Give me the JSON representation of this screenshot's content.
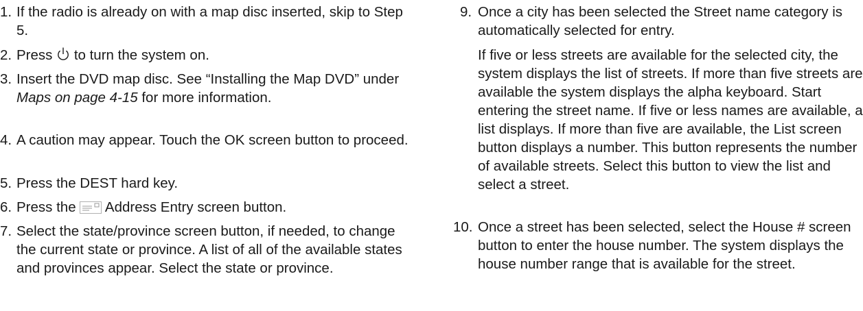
{
  "left_column": {
    "step1": {
      "num": "1.",
      "text": "If the radio is already on with a map disc inserted, skip to Step 5."
    },
    "step2": {
      "num": "2.",
      "pre": "Press",
      "icon": "power-icon",
      "post": "to turn the system on."
    },
    "step3": {
      "num": "3.",
      "pre": "Insert the DVD map disc. See “Installing the Map DVD” under",
      "italic": "Maps on page 4‑15",
      "post": "for more information."
    },
    "step4": {
      "num": "4.",
      "text": "A caution may appear. Touch the OK screen button to proceed."
    },
    "step5": {
      "num": "5.",
      "text": "Press the DEST hard key."
    },
    "step6": {
      "num": "6.",
      "pre": "Press the",
      "icon": "address-entry-icon",
      "post": "Address Entry screen button."
    },
    "step7": {
      "num": "7.",
      "text": "Select the state/province screen button, if needed, to change the current state or province. A list of all of the available states and provinces appear. Select the state or province."
    }
  },
  "right_column": {
    "step9": {
      "num": "9.",
      "text": "Once a city has been selected the Street name category is automatically selected for entry."
    },
    "step9_detail": "If five or less streets are available for the selected city, the system displays the list of streets. If more than five streets are available the system displays the alpha keyboard. Start entering the street name. If five or less names are available, a list displays. If more than five are available, the List screen button displays a number. This button represents the number of available streets. Select this button to view the list and select a street.",
    "step10": {
      "num": "10.",
      "text": "Once a street has been selected, select the House # screen button to enter the house number. The system displays the house number range that is available for the street."
    }
  }
}
